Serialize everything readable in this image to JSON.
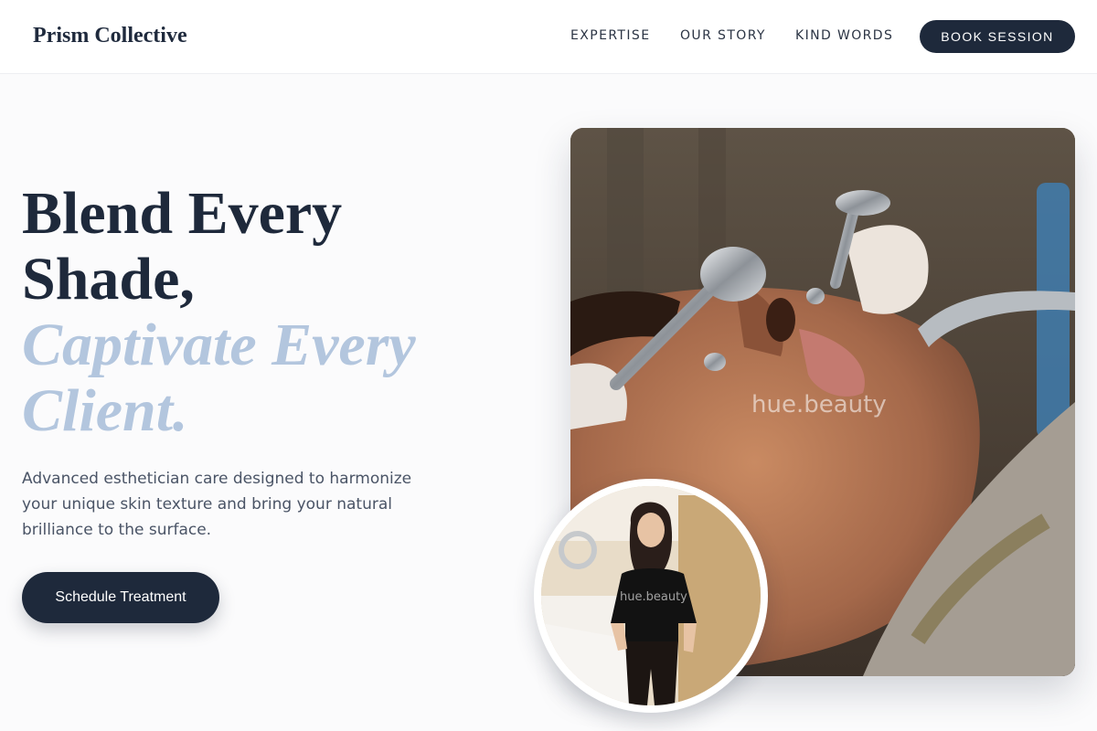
{
  "header": {
    "brand": "Prism Collective",
    "nav": [
      "EXPERTISE",
      "OUR STORY",
      "KIND WORDS"
    ],
    "cta": "BOOK SESSION"
  },
  "hero": {
    "headline_line1": "Blend Every",
    "headline_line2": "Shade,",
    "headline_accent1": "Captivate Every",
    "headline_accent2": "Client.",
    "lead": "Advanced esthetician care designed to harmonize your unique skin texture and bring your natural brilliance to the surface.",
    "cta": "Schedule Treatment"
  },
  "images": {
    "main_watermark": "hue.beauty",
    "round_watermark": "hue.beauty"
  },
  "colors": {
    "primary": "#1e293b",
    "accent": "#b3c6de",
    "background": "#fbfbfc"
  }
}
